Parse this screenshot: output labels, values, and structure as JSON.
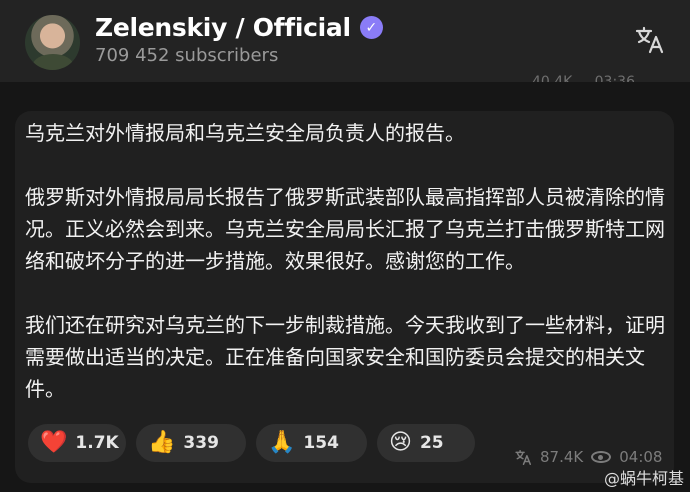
{
  "channel": {
    "name": "Zelenskiy / Official",
    "subscribers": "709 452 subscribers",
    "verified_icon": "verified-badge-icon",
    "verified_color": "#8a7cf7"
  },
  "previous_message": {
    "views": "40.4K",
    "time": "03:36"
  },
  "message": {
    "paragraphs": [
      "乌克兰对外情报局和乌克兰安全局负责人的报告。",
      "俄罗斯对外情报局局长报告了俄罗斯武装部队最高指挥部人员被清除的情况。正义必然会到来。乌克兰安全局局长汇报了乌克兰打击俄罗斯特工网络和破坏分子的进一步措施。效果很好。感谢您的工作。",
      "我们还在研究对乌克兰的下一步制裁措施。今天我收到了一些材料，证明需要做出适当的决定。正在准备向国家安全和国防委员会提交的相关文件。"
    ],
    "reactions": [
      {
        "emoji": "❤️",
        "count": "1.7K"
      },
      {
        "emoji": "👍",
        "count": "339"
      },
      {
        "emoji": "🙏",
        "count": "154"
      },
      {
        "emoji": "😢",
        "count": "25"
      }
    ],
    "views": "87.4K",
    "time": "04:08"
  },
  "watermark": "@蜗牛柯基",
  "colors": {
    "background": "#161616",
    "header": "#232323",
    "bubble": "#202020",
    "reaction": "#303030"
  }
}
